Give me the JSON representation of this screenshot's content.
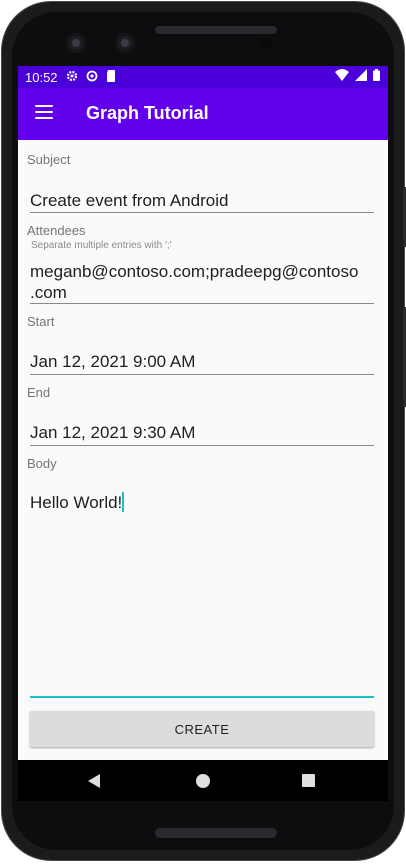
{
  "status_bar": {
    "time": "10:52"
  },
  "app_bar": {
    "title": "Graph Tutorial"
  },
  "form": {
    "subject_label": "Subject",
    "subject_value": "Create event from Android",
    "attendees_label": "Attendees",
    "attendees_hint": "Separate multiple entries with ';'",
    "attendees_value_line1": "meganb@contoso.com;pradeepg@contoso",
    "attendees_value_line2": ".com",
    "start_label": "Start",
    "start_value": "Jan 12, 2021 9:00 AM",
    "end_label": "End",
    "end_value": "Jan 12, 2021 9:30 AM",
    "body_label": "Body",
    "body_value": "Hello World!",
    "create_button": "CREATE"
  },
  "colors": {
    "status_bar": "#4b00d9",
    "app_bar": "#6200ee",
    "accent": "#19c2c9"
  }
}
